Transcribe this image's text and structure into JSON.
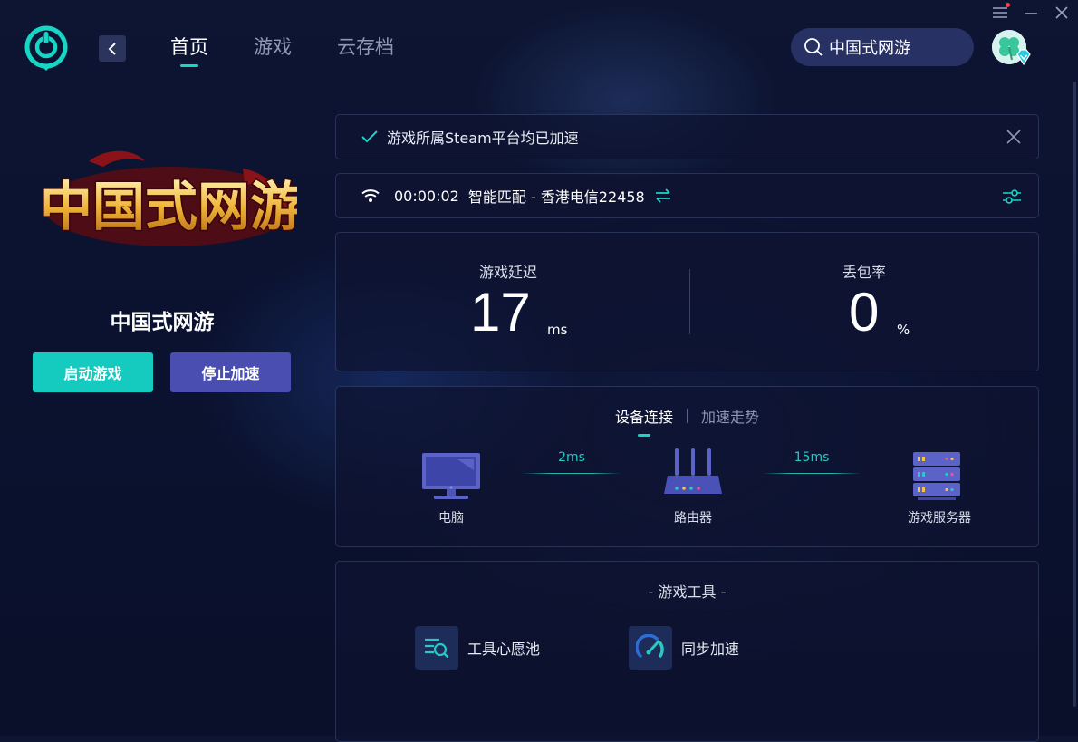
{
  "nav": {
    "items": [
      "首页",
      "游戏",
      "云存档"
    ],
    "active": "首页"
  },
  "search": {
    "value": "中国式网游"
  },
  "game": {
    "title": "中国式网游",
    "start_label": "启动游戏",
    "stop_label": "停止加速"
  },
  "notice": {
    "text": "游戏所属Steam平台均已加速"
  },
  "connection": {
    "duration": "00:00:02",
    "route": "智能匹配 - 香港电信22458"
  },
  "stats": {
    "latency_label": "游戏延迟",
    "latency_value": "17",
    "latency_unit": "ms",
    "loss_label": "丢包率",
    "loss_value": "0",
    "loss_unit": "%"
  },
  "device": {
    "tabs": [
      "设备连接",
      "加速走势"
    ],
    "pc_label": "电脑",
    "router_label": "路由器",
    "server_label": "游戏服务器",
    "pc_router_ms": "2ms",
    "router_server_ms": "15ms"
  },
  "tools": {
    "title": "- 游戏工具 -",
    "items": [
      "工具心愿池",
      "同步加速"
    ]
  },
  "colors": {
    "accent": "#16d6c6",
    "stop_button": "#4a4eb0",
    "background": "#0b1230"
  }
}
